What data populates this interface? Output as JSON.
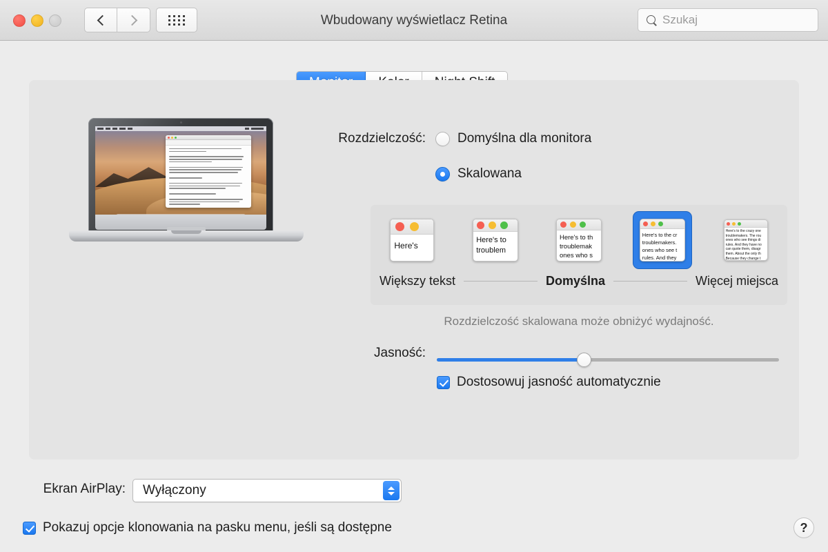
{
  "window": {
    "title": "Wbudowany wyświetlacz Retina",
    "traffic_lights": [
      "close",
      "minimize",
      "zoom"
    ],
    "nav": {
      "back": "‹",
      "forward": "›",
      "grid": "show-all"
    }
  },
  "search": {
    "placeholder": "Szukaj",
    "value": "",
    "icon": "search-icon"
  },
  "tabs": [
    {
      "label": "Monitor",
      "active": true
    },
    {
      "label": "Kolor",
      "active": false
    },
    {
      "label": "Night Shift",
      "active": false
    }
  ],
  "resolution": {
    "label": "Rozdzielczość:",
    "options": [
      {
        "label": "Domyślna dla monitora",
        "selected": false
      },
      {
        "label": "Skalowana",
        "selected": true
      }
    ]
  },
  "scaling": {
    "selected_index": 3,
    "thumbnails": [
      {
        "text": "Here's",
        "dots": 2
      },
      {
        "text": "Here's to\ntroublem",
        "dots": 3
      },
      {
        "text": "Here's to th\ntroublemak\nones who s",
        "dots": 3
      },
      {
        "text": "Here's to the cr\ntroublemakers.\nones who see t\nrules. And they",
        "dots": 3
      },
      {
        "text": "Here's to the crazy one\ntroublemakers. The rou\nones who see things di\nrules. And they have no\ncan quote them, disagr\nthem. About the only th\nBecause they change t",
        "dots": 3
      }
    ],
    "legend_left": "Większy tekst",
    "legend_mid": "Domyślna",
    "legend_right": "Więcej miejsca",
    "note": "Rozdzielczość skalowana może obniżyć wydajność."
  },
  "brightness": {
    "label": "Jasność:",
    "value_percent": 43,
    "auto_adjust": {
      "label": "Dostosowuj jasność automatycznie",
      "checked": true
    }
  },
  "airplay": {
    "label": "Ekran AirPlay:",
    "value": "Wyłączony",
    "options": [
      "Wyłączony"
    ]
  },
  "mirror_option": {
    "label": "Pokazuj opcje klonowania na pasku menu, jeśli są dostępne",
    "checked": true
  },
  "help": {
    "label": "?"
  },
  "colors": {
    "accent_blue": "#2f7fe8",
    "window_bg": "#ececec",
    "panel_bg": "#e4e4e4",
    "scaling_bg": "#dedede",
    "dot_red": "#f55f52",
    "dot_yellow": "#f6bd32",
    "dot_green": "#4fc04a",
    "text": "#1d1d1d",
    "muted_text": "#7b7b7b"
  }
}
